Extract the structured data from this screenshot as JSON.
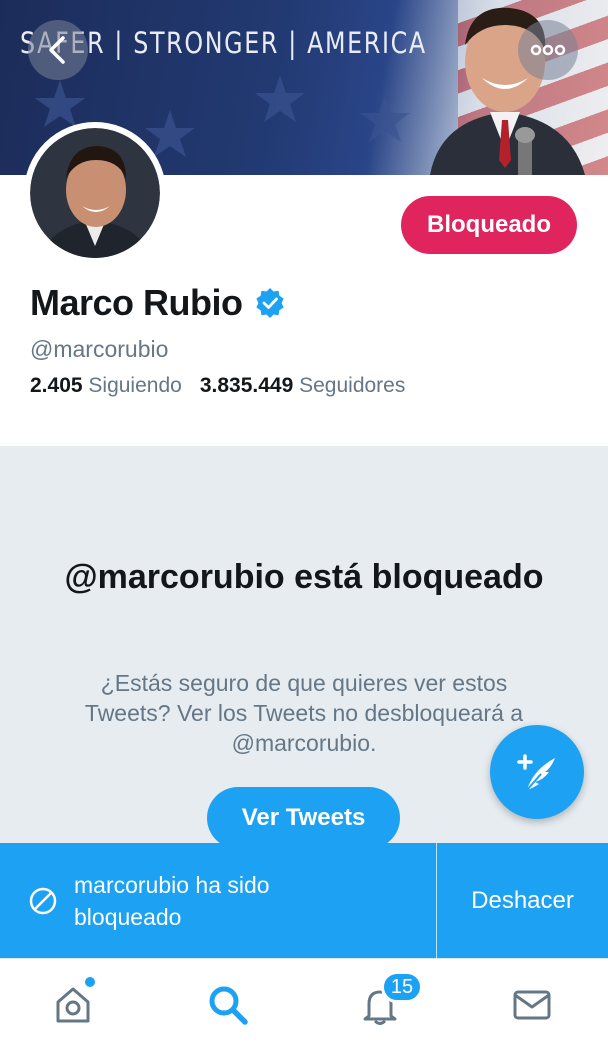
{
  "header": {
    "banner_slogan": "SAFER | STRONGER | AMERICA",
    "back_icon": "chevron-left-icon",
    "more_icon": "more-dots-icon"
  },
  "profile": {
    "name": "Marco Rubio",
    "verified": true,
    "handle": "@marcorubio",
    "following_count": "2.405",
    "following_label": "Siguiendo",
    "followers_count": "3.835.449",
    "followers_label": "Seguidores",
    "blocked_button_label": "Bloqueado"
  },
  "blocked_notice": {
    "title": "@marcorubio está bloqueado",
    "description": "¿Estás seguro de que quieres ver estos Tweets? Ver los Tweets no desbloqueará a @marcorubio.",
    "view_button_label": "Ver Tweets"
  },
  "snackbar": {
    "message": "marcorubio ha sido bloqueado",
    "undo_label": "Deshacer"
  },
  "tabbar": {
    "notifications_badge": "15",
    "items": [
      "home-icon",
      "search-icon",
      "notifications-icon",
      "messages-icon"
    ]
  },
  "colors": {
    "accent": "#1da1f2",
    "blocked": "#e0245e",
    "panel_bg": "#e6ecf0",
    "muted_text": "#657786"
  }
}
